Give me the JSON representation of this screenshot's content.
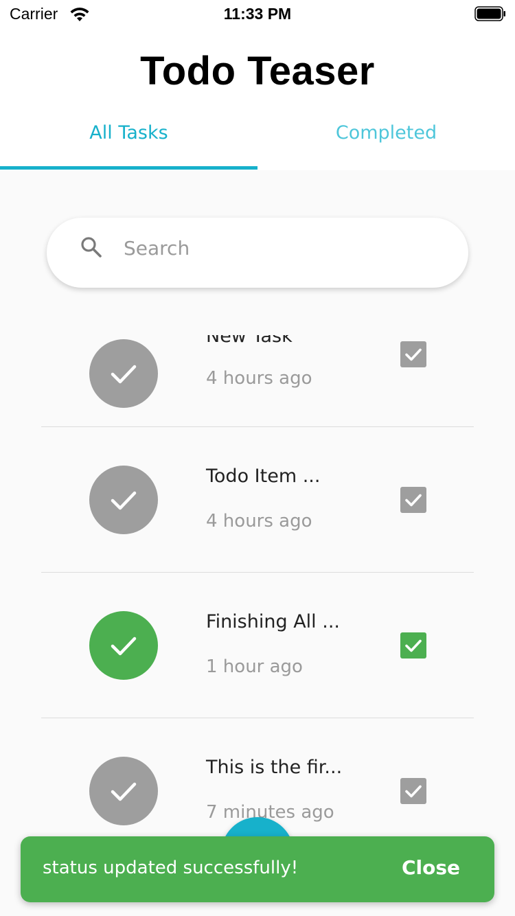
{
  "status_bar": {
    "carrier": "Carrier",
    "time": "11:33 PM",
    "wifi_icon": "wifi-icon",
    "battery_icon": "battery-icon"
  },
  "header": {
    "title": "Todo Teaser",
    "tabs": [
      {
        "label": "All Tasks",
        "selected": true
      },
      {
        "label": "Completed",
        "selected": false
      }
    ]
  },
  "search": {
    "placeholder": "Search",
    "icon": "search-icon"
  },
  "tasks": [
    {
      "title": "New Task",
      "time": "4 hours ago",
      "completed": false
    },
    {
      "title": "Todo Item ...",
      "time": "4 hours ago",
      "completed": false
    },
    {
      "title": "Finishing All ...",
      "time": "1 hour ago",
      "completed": true
    },
    {
      "title": "This is the fir...",
      "time": "7 minutes ago",
      "completed": false
    }
  ],
  "snackbar": {
    "message": "status updated successfully!",
    "action": "Close"
  },
  "colors": {
    "accent": "#17b1cb",
    "done": "#4caf50",
    "pending": "#9e9e9e"
  }
}
